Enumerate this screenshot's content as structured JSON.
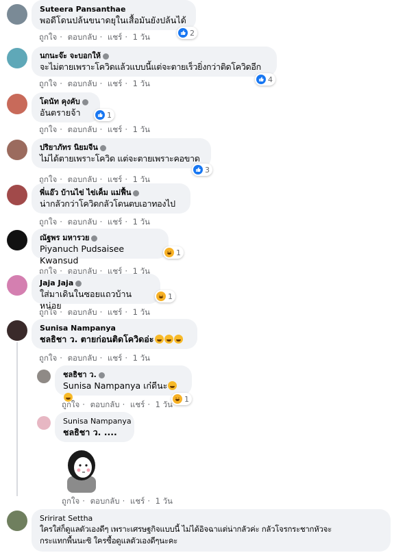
{
  "colors": {
    "bubble": "#f0f2f5",
    "meta": "#65676b",
    "like": "#1877f2",
    "haha": "#f7b125"
  },
  "actions": {
    "like": "ถูกใจ",
    "reply": "ตอบกลับ",
    "share": "แชร์",
    "sep": "·"
  },
  "comments": [
    {
      "name": "Suteera Pansanthae",
      "text": "พอดีโดนปล้นขนาดยุในเสื้อมันยังปล้นได้",
      "time": "1 วัน",
      "reaction": "like",
      "count": "2"
    },
    {
      "name": "นกนะจ๊ะ จะบอกให้",
      "text": "จะไม่ตายเพราะโควิดแล้วแบบนี้แต่จะตายเร็วยิ่งกว่าติดโควิดอีก",
      "time": "1 วัน",
      "reaction": "like",
      "count": "4"
    },
    {
      "name": "โดนัท คุงคับ",
      "text": "อันตรายจ้า",
      "time": "1 วัน",
      "reaction": "like",
      "count": "1"
    },
    {
      "name": "ปริยาภัทร นิยมจีน",
      "text": "ไม่ได้ตายเพราะโควิด แต่จะตายเพราะคอขาด",
      "time": "1 วัน",
      "reaction": "like",
      "count": "3"
    },
    {
      "name": "พี่แอ๊ว บ้านไข่ ไข่เค็ม แม่ฟื้น",
      "text": "น่ากลัวกว่าโควิดกลัวโดนตบเอาทองไป",
      "time": "1 วัน",
      "reaction": "",
      "count": ""
    },
    {
      "name": "ณัฐพร มหารวย",
      "text": "Piyanuch Pudsaisee Kwansud",
      "time": "1 วัน",
      "reaction": "haha",
      "count": "1"
    },
    {
      "name": "Jaja Jaja",
      "text": "ใส่มาเดินในซอยแถวบ้านหน่อย",
      "time": "1 วัน",
      "reaction": "haha",
      "count": "1"
    },
    {
      "name": "Sunisa Nampanya",
      "text": "ชลธิชา ว. ตายก่อนติดโควิดอ่ะ",
      "time": "1 วัน",
      "reaction": "",
      "count": ""
    }
  ],
  "replies": [
    {
      "name": "ชลธิชา ว.",
      "text": "Sunisa Nampanya เก๋ดีนะ",
      "time": "1 วัน",
      "reaction": "haha",
      "count": "1"
    },
    {
      "name": "Sunisa Nampanya",
      "text": "ชลธิชา ว. ....",
      "time": "1 วัน"
    }
  ],
  "last": {
    "name": "Sririrat Settha",
    "line1": "ใครใส่ก็ดูแลตัวเองดีๆ เพราะเศรษฐกิจแบบนี้ ไม่ได้อิจฉาแต่น่ากลัวค่ะ กลัวโจรกระชากหัวจะ",
    "line2": "กระแทกพื้นนะซิ ใครซื้อดูแลตัวเองดีๆนะคะ"
  }
}
